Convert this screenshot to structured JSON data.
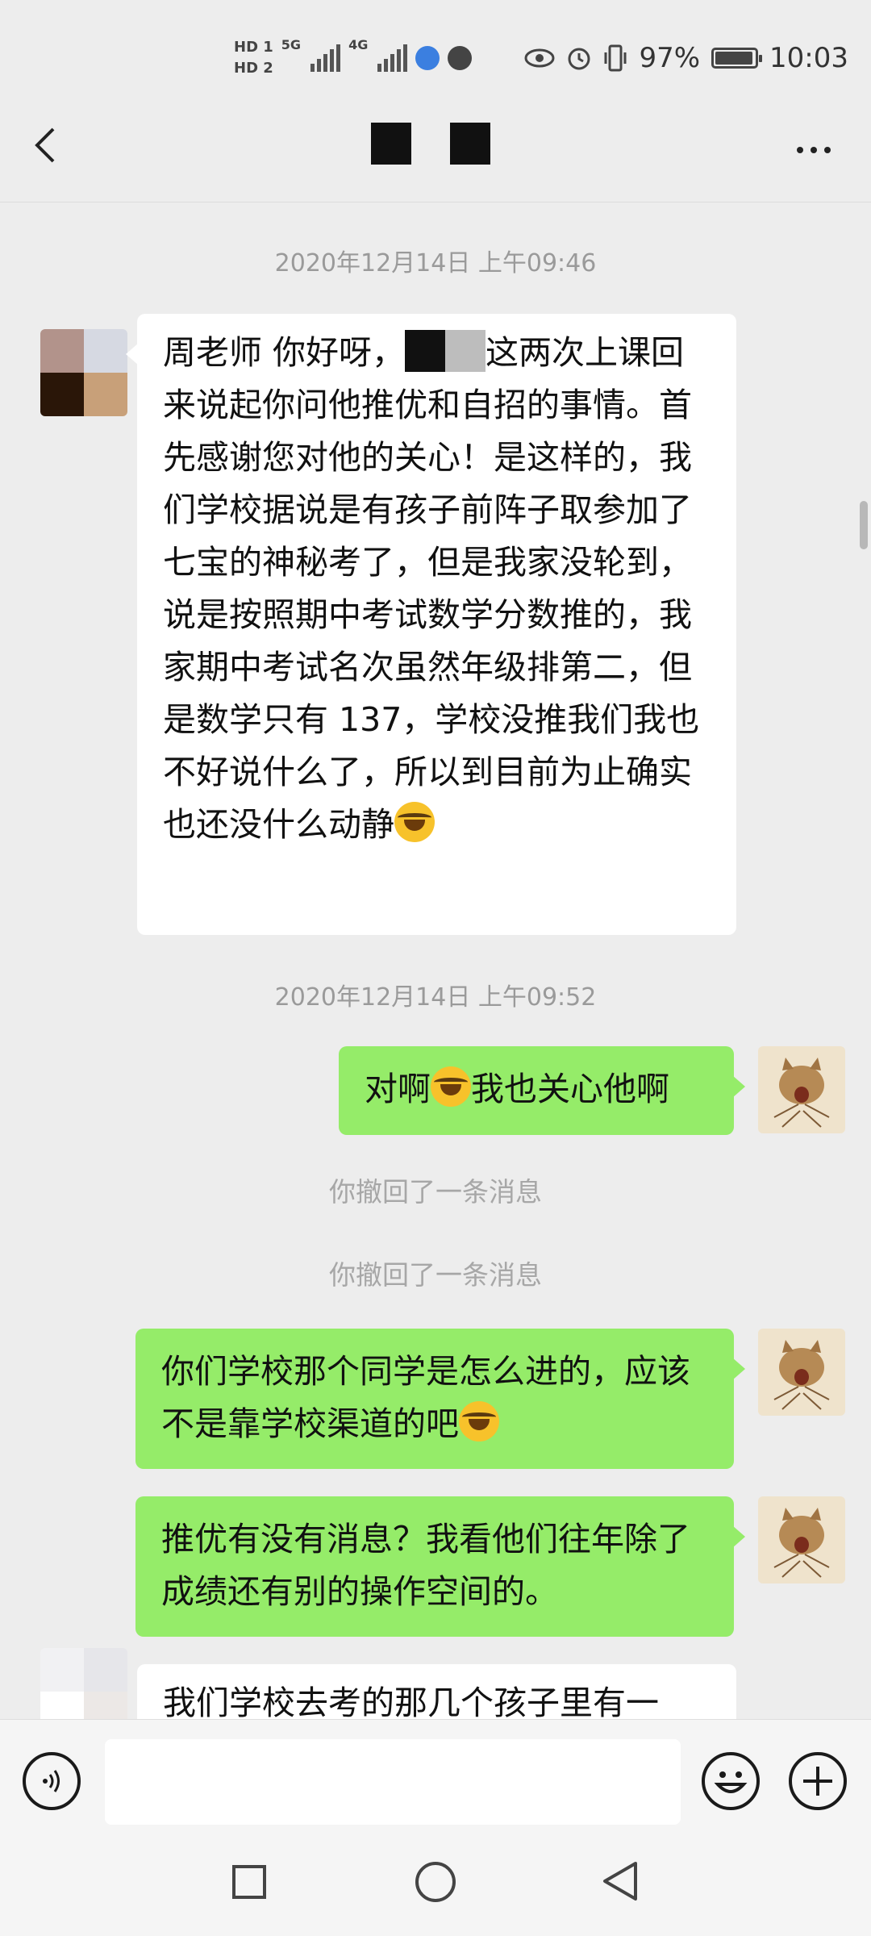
{
  "status_bar": {
    "hd1": "HD 1",
    "hd2": "HD 2",
    "net1": "5G",
    "net2": "4G",
    "battery_percent": "97%",
    "battery_level": 0.97,
    "time": "10:03"
  },
  "header": {
    "back_icon": "chevron-left-icon",
    "more_icon": "more-dots-icon"
  },
  "messages": [
    {
      "type": "timestamp",
      "text": "2020年12月14日 上午09:46"
    },
    {
      "type": "incoming",
      "parts": [
        "周老师 你好呀，",
        "这两次上课回来说起你问他推优和自招的事情。首先感谢您对他的关心！是这样的，我们学校据说是有孩子前阵子取参加了七宝的神秘考了，但是我家没轮到，说是按照期中考试数学分数推的，我家期中考试名次虽然年级排第二，但是数学只有 137，学校没推我们我也不好说什么了，所以到目前为止确实也还没什么动静"
      ]
    },
    {
      "type": "timestamp",
      "text": "2020年12月14日 上午09:52"
    },
    {
      "type": "outgoing",
      "parts": [
        "对啊",
        "我也关心他啊"
      ]
    },
    {
      "type": "system",
      "text": "你撤回了一条消息"
    },
    {
      "type": "system",
      "text": "你撤回了一条消息"
    },
    {
      "type": "outgoing",
      "parts": [
        "你们学校那个同学是怎么进的，应该不是靠学校渠道的吧"
      ]
    },
    {
      "type": "outgoing",
      "parts": [
        "推优有没有消息？我看他们往年除了成绩还有别的操作空间的。"
      ]
    },
    {
      "type": "incoming",
      "parts": [
        "我们学校去考的那几个孩子里有一"
      ]
    }
  ],
  "input_bar": {
    "voice_icon": "voice-icon",
    "emoji_icon": "emoji-icon",
    "plus_icon": "plus-icon"
  },
  "nav_bar": {
    "recent_icon": "square-icon",
    "home_icon": "circle-icon",
    "back_icon": "triangle-back-icon"
  }
}
